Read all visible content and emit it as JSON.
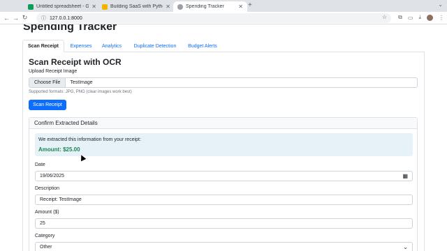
{
  "browser": {
    "tabs": [
      {
        "title": "Untitled spreadsheet - Googl",
        "favicon_color": "#0f9d58",
        "active": false
      },
      {
        "title": "Building SaaS with Python A",
        "favicon_color": "#f4b400",
        "active": false
      },
      {
        "title": "Spending Tracker",
        "favicon_color": "#9aa0a6",
        "active": true
      }
    ],
    "url": "127.0.0.1:8000"
  },
  "app": {
    "title": "Spending Tracker",
    "tabs": [
      "Scan Receipt",
      "Expenses",
      "Analytics",
      "Duplicate Detection",
      "Budget Alerts"
    ],
    "active_tab": "Scan Receipt"
  },
  "scan": {
    "heading": "Scan Receipt with OCR",
    "upload_label": "Upload Receipt Image",
    "choose_file_label": "Choose File",
    "file_name": "TestImage",
    "hint": "Supported formats: JPG, PNG (clear images work best)",
    "scan_button": "Scan Receipt"
  },
  "confirm": {
    "header": "Confirm Extracted Details",
    "alert_message": "We extracted this information from your receipt:",
    "alert_amount": "Amount: $25.00",
    "date_label": "Date",
    "date_value": "19/06/2025",
    "description_label": "Description",
    "description_value": "Receipt: TestImage",
    "amount_label": "Amount ($)",
    "amount_value": "25",
    "category_label": "Category",
    "category_value": "Other"
  },
  "colors": {
    "primary": "#0d6efd",
    "success": "#198754"
  }
}
